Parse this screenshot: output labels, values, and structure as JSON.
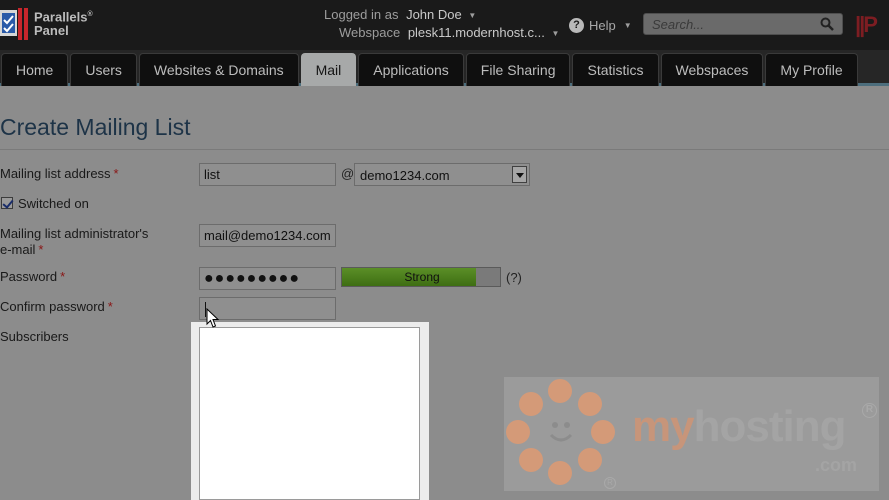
{
  "app": {
    "brand_line1": "Parallels",
    "brand_line2": "Panel",
    "brand_reg": "®",
    "right_brand": "||P"
  },
  "header": {
    "logged_in_label": "Logged in as",
    "user_name": "John Doe",
    "webspace_label": "Webspace",
    "webspace_value": "plesk11.modernhost.c...",
    "help_label": "Help",
    "search_placeholder": "Search..."
  },
  "tabs": [
    {
      "label": "Home",
      "active": false
    },
    {
      "label": "Users",
      "active": false
    },
    {
      "label": "Websites & Domains",
      "active": false
    },
    {
      "label": "Mail",
      "active": true
    },
    {
      "label": "Applications",
      "active": false
    },
    {
      "label": "File Sharing",
      "active": false
    },
    {
      "label": "Statistics",
      "active": false
    },
    {
      "label": "Webspaces",
      "active": false
    },
    {
      "label": "My Profile",
      "active": false
    }
  ],
  "page": {
    "title": "Create Mailing List"
  },
  "form": {
    "address_label": "Mailing list address",
    "required_mark": "*",
    "address_value": "list",
    "at": "@",
    "domain_value": "demo1234.com",
    "switched_on_label": "Switched on",
    "switched_on_checked": true,
    "admin_label_line1": "Mailing list administrator's",
    "admin_label_line2": "e-mail",
    "admin_value": "mail@demo1234.com",
    "password_label": "Password",
    "password_value": "●●●●●●●●●",
    "strength_label": "Strong",
    "strength_percent": 85,
    "hint": "(?)",
    "confirm_label": "Confirm password",
    "confirm_value": "",
    "subscribers_label": "Subscribers",
    "subscribers_value": ""
  },
  "watermark": {
    "my": "my",
    "hosting": "hosting",
    "com": ".com",
    "reg": "R"
  },
  "colors": {
    "title": "#1d3347",
    "active_tab": "#a7a9a9",
    "strength_fill": "#4f8420",
    "watermark_orange": "#c7957a"
  }
}
